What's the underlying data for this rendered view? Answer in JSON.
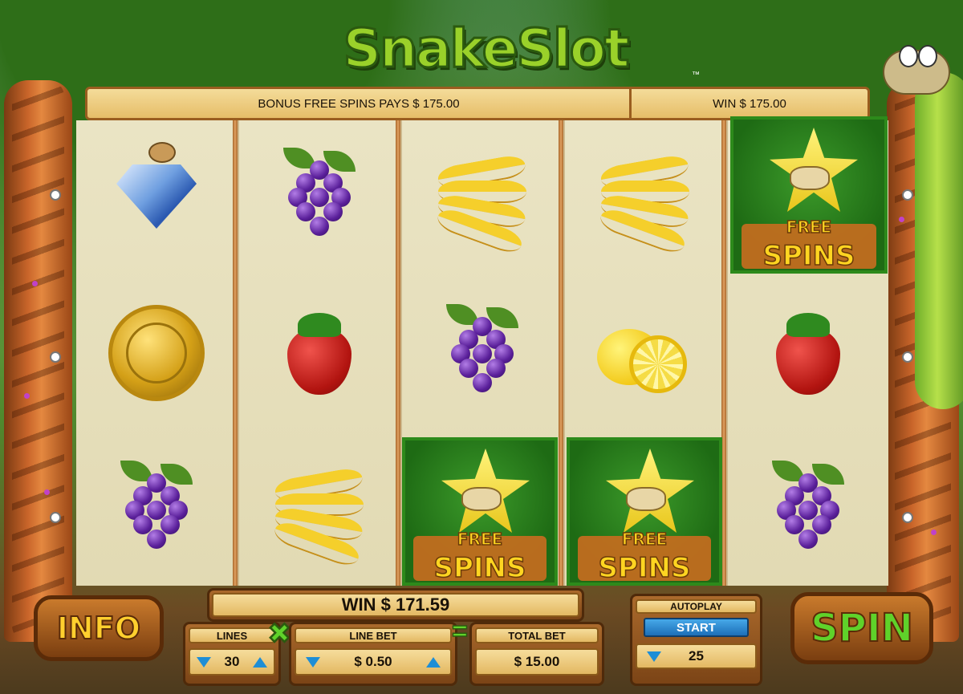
{
  "title": "SnakeSlot",
  "trademark": "™",
  "info_bar": {
    "bonus_text": "BONUS FREE SPINS PAYS $ 175.00",
    "win_text": "WIN $ 175.00"
  },
  "reels": [
    [
      "diamond",
      "gold-coin",
      "grapes"
    ],
    [
      "grapes",
      "strawberry",
      "bananas"
    ],
    [
      "bananas",
      "grapes",
      "free-spins"
    ],
    [
      "bananas",
      "lemons",
      "free-spins"
    ],
    [
      "free-spins",
      "strawberry",
      "grapes"
    ]
  ],
  "free_spins_symbol": {
    "line1": "FREE",
    "line2": "SPINS"
  },
  "win_panel": {
    "text": "WIN $ 171.59"
  },
  "controls": {
    "lines_label": "LINES",
    "lines_value": "30",
    "multiply": "✖",
    "line_bet_label": "LINE BET",
    "line_bet_value": "$ 0.50",
    "equals": "=",
    "total_bet_label": "TOTAL BET",
    "total_bet_value": "$ 15.00",
    "autoplay_label": "AUTOPLAY",
    "autoplay_start": "START",
    "autoplay_value": "25"
  },
  "buttons": {
    "info": "INFO",
    "spin": "SPIN"
  },
  "colors": {
    "win_highlight": "#2d8a1b",
    "arrow": "#1e8ed6",
    "spin_text": "#5fd22a",
    "info_text": "#ffcf2e"
  }
}
